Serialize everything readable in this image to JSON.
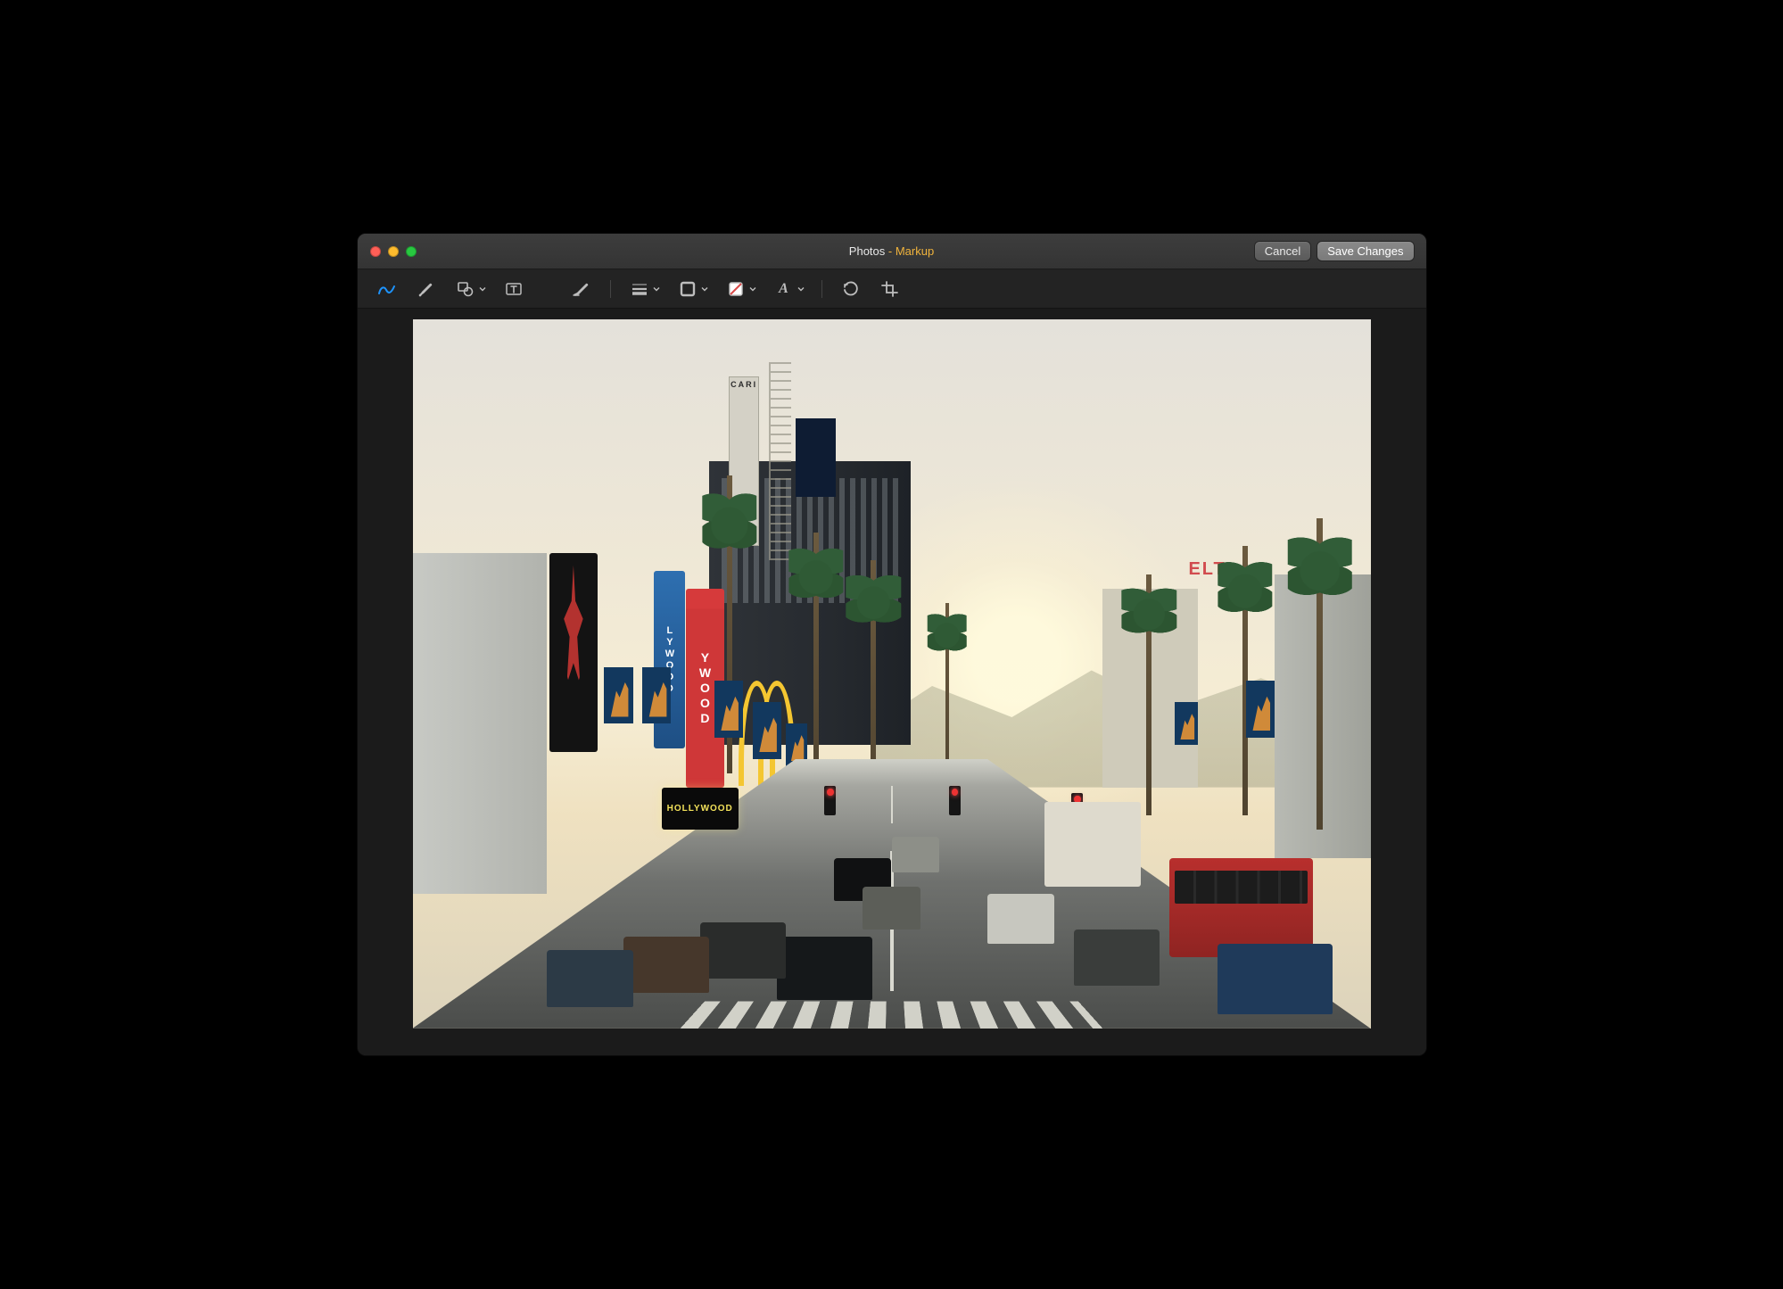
{
  "window": {
    "title_app": "Photos",
    "title_separator": " - ",
    "title_mode": "Markup",
    "cancel_label": "Cancel",
    "save_label": "Save Changes"
  },
  "toolbar": {
    "tools": {
      "sketch": "Sketch",
      "draw": "Draw",
      "shapes": "Shapes",
      "text": "Text",
      "sign": "Sign",
      "shape_style": "Shape Style",
      "border_color": "Border Color",
      "fill_color": "Fill Color",
      "text_style": "Text Style",
      "rotate": "Rotate Left",
      "crop": "Crop"
    }
  },
  "photo": {
    "sign_cari": "CARI",
    "sign_hollywood_vert_1": "YWOOD",
    "sign_hollywood_vert_2": "LYWOOD",
    "sign_elt": "ELT",
    "sign_hollywood_neon": "HOLLYWOOD"
  },
  "colors": {
    "accent": "#1d94ff",
    "fill_none_stroke": "#d94b4a",
    "title_mode": "#f0b33c"
  }
}
